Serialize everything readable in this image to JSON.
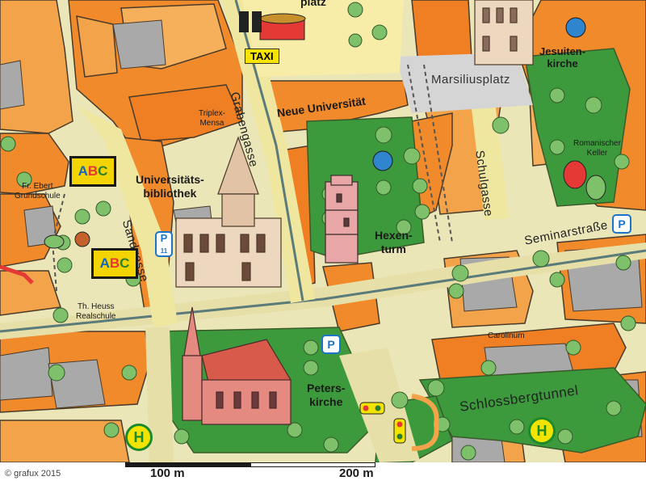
{
  "map": {
    "places": {
      "platz_top": "platz",
      "taxi": "TAXI",
      "jesuitenkirche": "Jesuiten-\nkirche",
      "marsiliusplatz": "Marsiliusplatz",
      "neue_universitaet": "Neue Universität",
      "triplex_mensa": "Triplex-\nMensa",
      "romanischer_keller": "Romanischer\nKeller",
      "fr_ebert_grundschule": "Fr. Ebert\nGrundschule",
      "universitaetsbibliothek": "Universitäts-\nbibliothek",
      "hexenturm": "Hexen-\nturm",
      "th_heuss_realschule": "Th. Heuss\nRealschule",
      "carolinum": "Carolinum",
      "peterskirche": "Peters-\nkirche",
      "schlossbergtunnel": "Schlossbergtunnel"
    },
    "streets": {
      "grabengasse": "Grabengasse",
      "sandgasse": "Sandgasse",
      "schulgasse": "Schulgasse",
      "seminarstrasse": "Seminarstraße"
    },
    "icons": {
      "bus_stop_letter": "H",
      "parking_letter": "P",
      "parking_11_number": "11",
      "abc_sign": [
        "A",
        "B",
        "C"
      ]
    },
    "scale": {
      "label_100": "100 m",
      "label_200": "200 m"
    },
    "copyright": "© grafux 2015"
  }
}
